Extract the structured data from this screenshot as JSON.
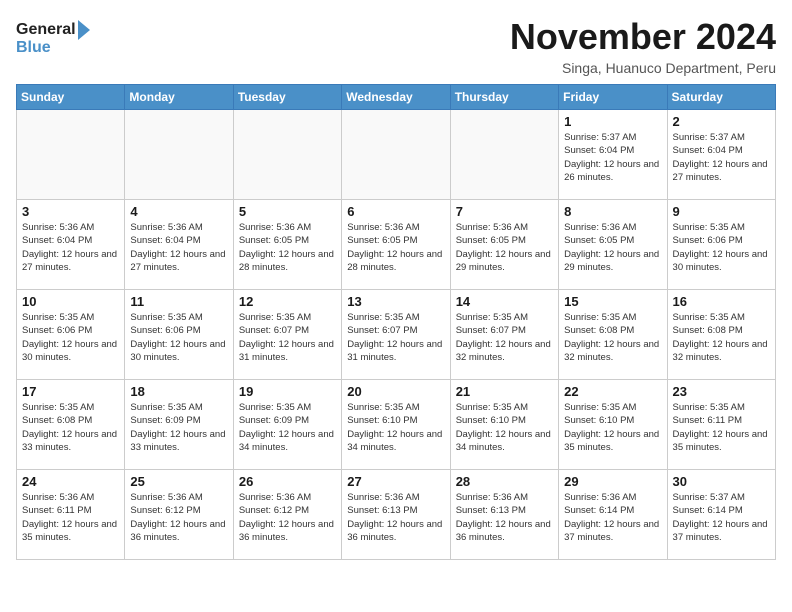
{
  "logo": {
    "line1": "General",
    "line2": "Blue"
  },
  "title": "November 2024",
  "location": "Singa, Huanuco Department, Peru",
  "days_header": [
    "Sunday",
    "Monday",
    "Tuesday",
    "Wednesday",
    "Thursday",
    "Friday",
    "Saturday"
  ],
  "weeks": [
    [
      {
        "day": "",
        "info": ""
      },
      {
        "day": "",
        "info": ""
      },
      {
        "day": "",
        "info": ""
      },
      {
        "day": "",
        "info": ""
      },
      {
        "day": "",
        "info": ""
      },
      {
        "day": "1",
        "info": "Sunrise: 5:37 AM\nSunset: 6:04 PM\nDaylight: 12 hours and 26 minutes."
      },
      {
        "day": "2",
        "info": "Sunrise: 5:37 AM\nSunset: 6:04 PM\nDaylight: 12 hours and 27 minutes."
      }
    ],
    [
      {
        "day": "3",
        "info": "Sunrise: 5:36 AM\nSunset: 6:04 PM\nDaylight: 12 hours and 27 minutes."
      },
      {
        "day": "4",
        "info": "Sunrise: 5:36 AM\nSunset: 6:04 PM\nDaylight: 12 hours and 27 minutes."
      },
      {
        "day": "5",
        "info": "Sunrise: 5:36 AM\nSunset: 6:05 PM\nDaylight: 12 hours and 28 minutes."
      },
      {
        "day": "6",
        "info": "Sunrise: 5:36 AM\nSunset: 6:05 PM\nDaylight: 12 hours and 28 minutes."
      },
      {
        "day": "7",
        "info": "Sunrise: 5:36 AM\nSunset: 6:05 PM\nDaylight: 12 hours and 29 minutes."
      },
      {
        "day": "8",
        "info": "Sunrise: 5:36 AM\nSunset: 6:05 PM\nDaylight: 12 hours and 29 minutes."
      },
      {
        "day": "9",
        "info": "Sunrise: 5:35 AM\nSunset: 6:06 PM\nDaylight: 12 hours and 30 minutes."
      }
    ],
    [
      {
        "day": "10",
        "info": "Sunrise: 5:35 AM\nSunset: 6:06 PM\nDaylight: 12 hours and 30 minutes."
      },
      {
        "day": "11",
        "info": "Sunrise: 5:35 AM\nSunset: 6:06 PM\nDaylight: 12 hours and 30 minutes."
      },
      {
        "day": "12",
        "info": "Sunrise: 5:35 AM\nSunset: 6:07 PM\nDaylight: 12 hours and 31 minutes."
      },
      {
        "day": "13",
        "info": "Sunrise: 5:35 AM\nSunset: 6:07 PM\nDaylight: 12 hours and 31 minutes."
      },
      {
        "day": "14",
        "info": "Sunrise: 5:35 AM\nSunset: 6:07 PM\nDaylight: 12 hours and 32 minutes."
      },
      {
        "day": "15",
        "info": "Sunrise: 5:35 AM\nSunset: 6:08 PM\nDaylight: 12 hours and 32 minutes."
      },
      {
        "day": "16",
        "info": "Sunrise: 5:35 AM\nSunset: 6:08 PM\nDaylight: 12 hours and 32 minutes."
      }
    ],
    [
      {
        "day": "17",
        "info": "Sunrise: 5:35 AM\nSunset: 6:08 PM\nDaylight: 12 hours and 33 minutes."
      },
      {
        "day": "18",
        "info": "Sunrise: 5:35 AM\nSunset: 6:09 PM\nDaylight: 12 hours and 33 minutes."
      },
      {
        "day": "19",
        "info": "Sunrise: 5:35 AM\nSunset: 6:09 PM\nDaylight: 12 hours and 34 minutes."
      },
      {
        "day": "20",
        "info": "Sunrise: 5:35 AM\nSunset: 6:10 PM\nDaylight: 12 hours and 34 minutes."
      },
      {
        "day": "21",
        "info": "Sunrise: 5:35 AM\nSunset: 6:10 PM\nDaylight: 12 hours and 34 minutes."
      },
      {
        "day": "22",
        "info": "Sunrise: 5:35 AM\nSunset: 6:10 PM\nDaylight: 12 hours and 35 minutes."
      },
      {
        "day": "23",
        "info": "Sunrise: 5:35 AM\nSunset: 6:11 PM\nDaylight: 12 hours and 35 minutes."
      }
    ],
    [
      {
        "day": "24",
        "info": "Sunrise: 5:36 AM\nSunset: 6:11 PM\nDaylight: 12 hours and 35 minutes."
      },
      {
        "day": "25",
        "info": "Sunrise: 5:36 AM\nSunset: 6:12 PM\nDaylight: 12 hours and 36 minutes."
      },
      {
        "day": "26",
        "info": "Sunrise: 5:36 AM\nSunset: 6:12 PM\nDaylight: 12 hours and 36 minutes."
      },
      {
        "day": "27",
        "info": "Sunrise: 5:36 AM\nSunset: 6:13 PM\nDaylight: 12 hours and 36 minutes."
      },
      {
        "day": "28",
        "info": "Sunrise: 5:36 AM\nSunset: 6:13 PM\nDaylight: 12 hours and 36 minutes."
      },
      {
        "day": "29",
        "info": "Sunrise: 5:36 AM\nSunset: 6:14 PM\nDaylight: 12 hours and 37 minutes."
      },
      {
        "day": "30",
        "info": "Sunrise: 5:37 AM\nSunset: 6:14 PM\nDaylight: 12 hours and 37 minutes."
      }
    ]
  ]
}
